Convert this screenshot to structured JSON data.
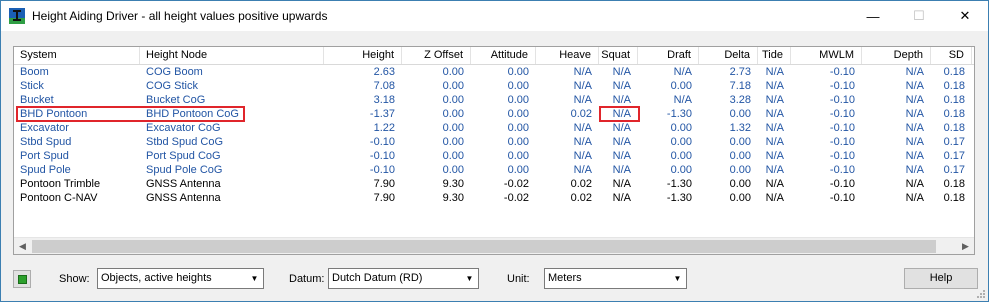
{
  "window": {
    "title": "Height Aiding Driver - all height values positive upwards",
    "icon": "app-icon",
    "controls": {
      "minimize": "—",
      "maximize": "☐",
      "close": "✕"
    }
  },
  "table": {
    "columns": [
      "System",
      "Height Node",
      "Height",
      "Z Offset",
      "Attitude",
      "Heave",
      "Squat",
      "Draft",
      "Delta",
      "Tide",
      "MWLM",
      "Depth",
      "SD"
    ],
    "rows": [
      [
        "Boom",
        "COG Boom",
        "2.63",
        "0.00",
        "0.00",
        "N/A",
        "N/A",
        "N/A",
        "2.73",
        "N/A",
        "-0.10",
        "N/A",
        "0.18"
      ],
      [
        "Stick",
        "COG Stick",
        "7.08",
        "0.00",
        "0.00",
        "N/A",
        "N/A",
        "0.00",
        "7.18",
        "N/A",
        "-0.10",
        "N/A",
        "0.18"
      ],
      [
        "Bucket",
        "Bucket CoG",
        "3.18",
        "0.00",
        "0.00",
        "N/A",
        "N/A",
        "N/A",
        "3.28",
        "N/A",
        "-0.10",
        "N/A",
        "0.18"
      ],
      [
        "BHD Pontoon",
        "BHD Pontoon CoG",
        "-1.37",
        "0.00",
        "0.00",
        "0.02",
        "N/A",
        "-1.30",
        "0.00",
        "N/A",
        "-0.10",
        "N/A",
        "0.18"
      ],
      [
        "Excavator",
        "Excavator CoG",
        "1.22",
        "0.00",
        "0.00",
        "N/A",
        "N/A",
        "0.00",
        "1.32",
        "N/A",
        "-0.10",
        "N/A",
        "0.18"
      ],
      [
        "Stbd Spud",
        "Stbd Spud CoG",
        "-0.10",
        "0.00",
        "0.00",
        "N/A",
        "N/A",
        "0.00",
        "0.00",
        "N/A",
        "-0.10",
        "N/A",
        "0.17"
      ],
      [
        "Port Spud",
        "Port Spud CoG",
        "-0.10",
        "0.00",
        "0.00",
        "N/A",
        "N/A",
        "0.00",
        "0.00",
        "N/A",
        "-0.10",
        "N/A",
        "0.17"
      ],
      [
        "Spud Pole",
        "Spud Pole CoG",
        "-0.10",
        "0.00",
        "0.00",
        "N/A",
        "N/A",
        "0.00",
        "0.00",
        "N/A",
        "-0.10",
        "N/A",
        "0.17"
      ],
      [
        "Pontoon Trimble",
        "GNSS Antenna",
        "7.90",
        "9.30",
        "-0.02",
        "0.02",
        "N/A",
        "-1.30",
        "0.00",
        "N/A",
        "-0.10",
        "N/A",
        "0.18"
      ],
      [
        "Pontoon C-NAV",
        "GNSS Antenna",
        "7.90",
        "9.30",
        "-0.02",
        "0.02",
        "N/A",
        "-1.30",
        "0.00",
        "N/A",
        "-0.10",
        "N/A",
        "0.18"
      ]
    ],
    "row_colors": [
      "blue",
      "blue",
      "blue",
      "blue",
      "blue",
      "blue",
      "blue",
      "blue",
      "black",
      "black"
    ],
    "highlighted_row": 3,
    "highlighted_cell": {
      "row": 3,
      "col": "Draft"
    },
    "colors": {
      "linked_text": "#2255a4",
      "highlight": "#e0252b"
    }
  },
  "controls": {
    "show_label": "Show:",
    "show_value": "Objects, active heights",
    "datum_label": "Datum:",
    "datum_value": "Dutch Datum (RD)",
    "unit_label": "Unit:",
    "unit_value": "Meters",
    "help_label": "Help"
  }
}
